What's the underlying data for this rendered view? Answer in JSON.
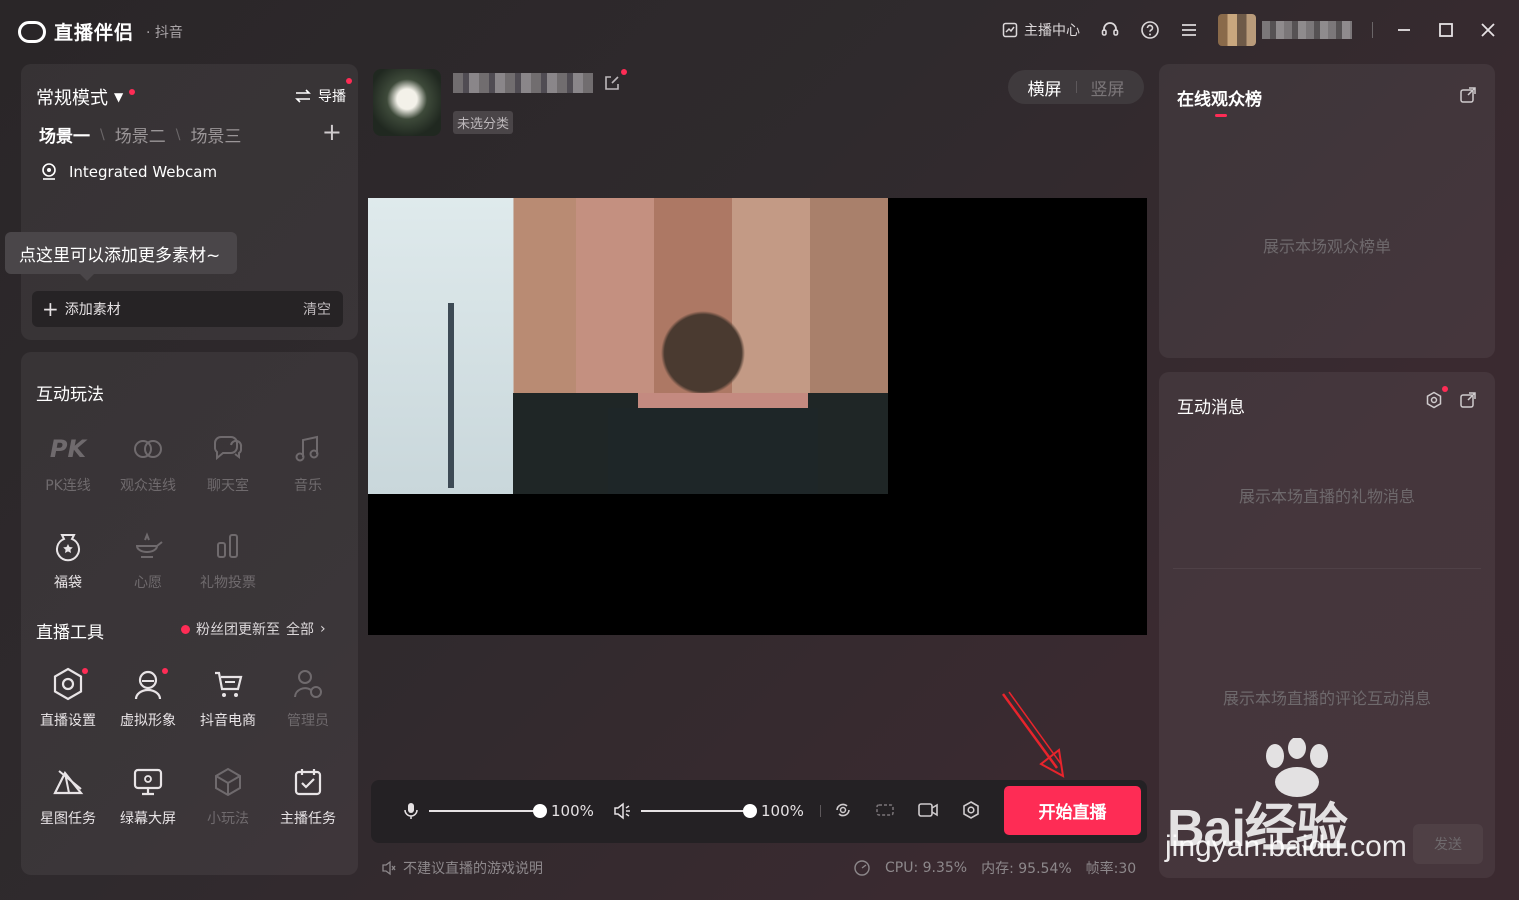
{
  "app": {
    "title": "直播伴侣",
    "platform": "· 抖音"
  },
  "titlebar": {
    "anchor_center": "主播中心"
  },
  "scene_panel": {
    "mode": "常规模式",
    "director": "导播",
    "scenes": [
      "场景一",
      "场景二",
      "场景三"
    ],
    "source": "Integrated Webcam",
    "tooltip": "点这里可以添加更多素材~",
    "add_material": "添加素材",
    "clear": "清空"
  },
  "tools_panel": {
    "interactive_title": "互动玩法",
    "interactive": [
      {
        "label": "PK连线",
        "enabled": false
      },
      {
        "label": "观众连线",
        "enabled": false
      },
      {
        "label": "聊天室",
        "enabled": false
      },
      {
        "label": "音乐",
        "enabled": false
      },
      {
        "label": "福袋",
        "enabled": true
      },
      {
        "label": "心愿",
        "enabled": false
      },
      {
        "label": "礼物投票",
        "enabled": false
      }
    ],
    "tools_title": "直播工具",
    "fans_update": "粉丝团更新至",
    "all": "全部",
    "tools": [
      {
        "label": "直播设置",
        "enabled": true
      },
      {
        "label": "虚拟形象",
        "enabled": true
      },
      {
        "label": "抖音电商",
        "enabled": true
      },
      {
        "label": "管理员",
        "enabled": false
      },
      {
        "label": "星图任务",
        "enabled": true
      },
      {
        "label": "绿幕大屏",
        "enabled": true
      },
      {
        "label": "小玩法",
        "enabled": false
      },
      {
        "label": "主播任务",
        "enabled": true
      }
    ]
  },
  "room": {
    "category": "未选分类"
  },
  "orientation": {
    "landscape": "横屏",
    "portrait": "竖屏"
  },
  "controls": {
    "mic_volume": "100%",
    "speaker_volume": "100%",
    "start_live": "开始直播"
  },
  "footer": {
    "game_notice": "不建议直播的游戏说明",
    "cpu": "CPU: 9.35%",
    "memory": "内存: 95.54%",
    "fps": "帧率:30"
  },
  "rank_panel": {
    "title": "在线观众榜",
    "placeholder": "展示本场观众榜单"
  },
  "message_panel": {
    "title": "互动消息",
    "gift_placeholder": "展示本场直播的礼物消息",
    "comment_placeholder": "展示本场直播的评论互动消息",
    "send": "发送"
  },
  "watermark": {
    "brand": "Bai经验",
    "url": "jingyan.baidu.com"
  },
  "colors": {
    "accent": "#fe2c55",
    "bg": "#2f2a2d"
  }
}
